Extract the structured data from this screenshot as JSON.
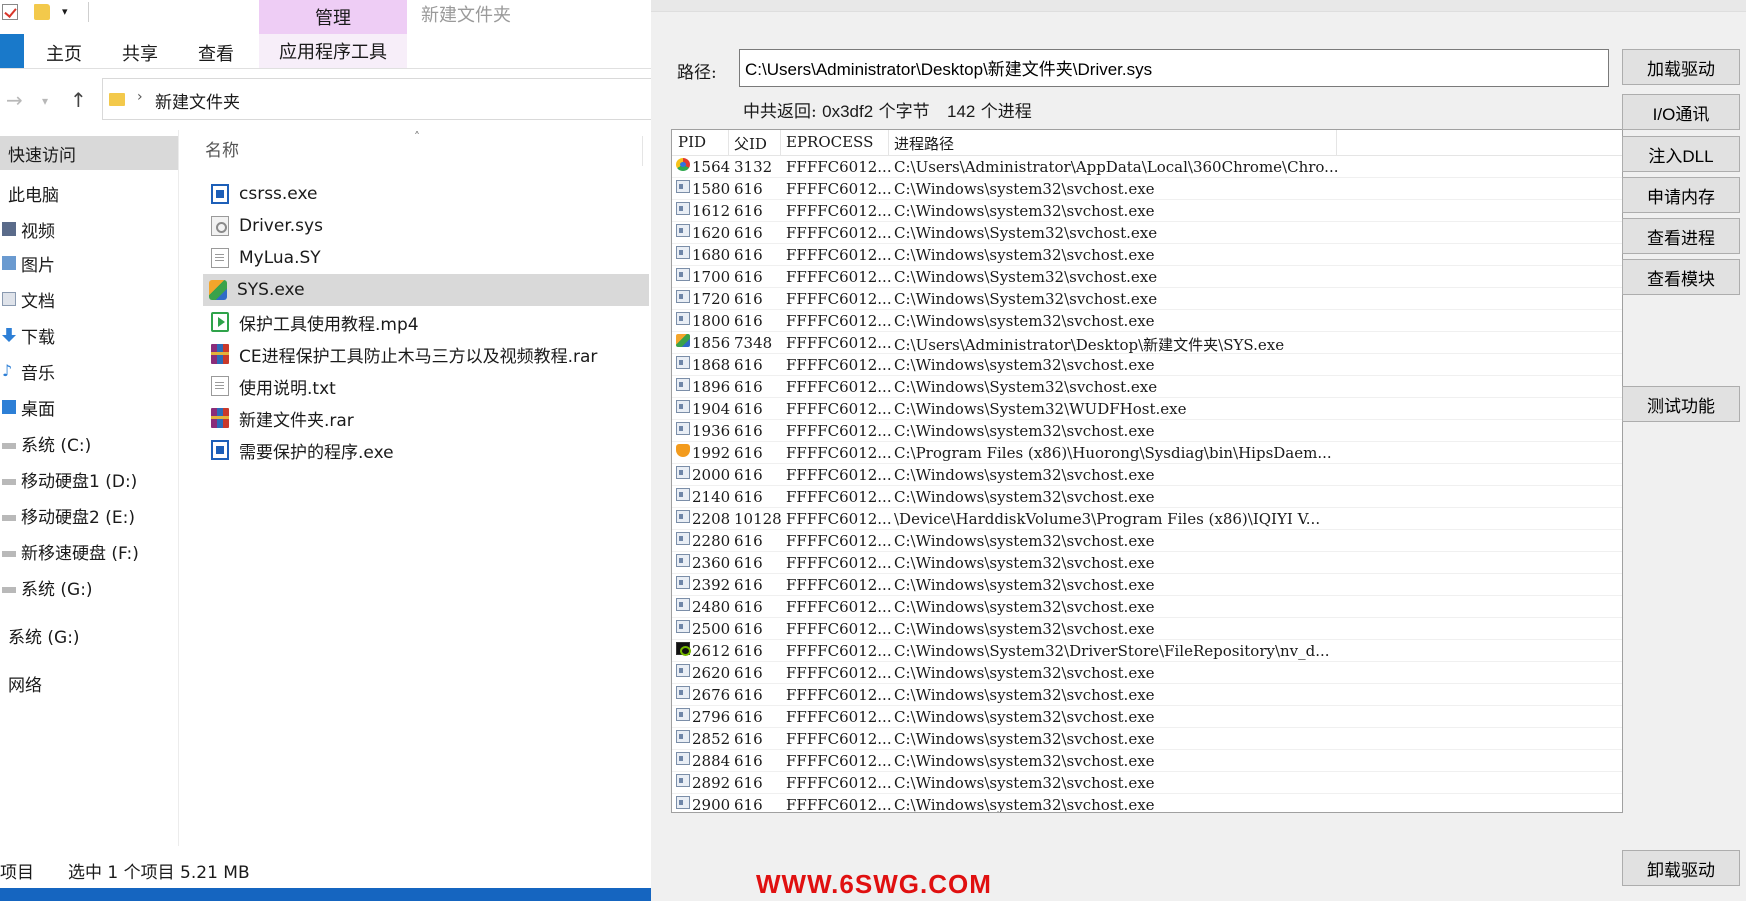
{
  "explorer": {
    "ribbon": {
      "manage_tab": "管理",
      "window_title": "新建文件夹",
      "tabs": [
        "主页",
        "共享",
        "查看"
      ],
      "app_tools_tab": "应用程序工具"
    },
    "address": {
      "current_folder": "新建文件夹"
    },
    "nav": [
      {
        "label": "快速访问",
        "icon": "star-icon"
      },
      {
        "label": "此电脑",
        "icon": "computer-icon"
      },
      {
        "label": "视频",
        "icon": "video-folder-icon"
      },
      {
        "label": "图片",
        "icon": "pictures-folder-icon"
      },
      {
        "label": "文档",
        "icon": "documents-folder-icon"
      },
      {
        "label": "下载",
        "icon": "download-folder-icon"
      },
      {
        "label": "音乐",
        "icon": "music-folder-icon"
      },
      {
        "label": "桌面",
        "icon": "desktop-folder-icon"
      },
      {
        "label": "系统 (C:)",
        "icon": "drive-icon"
      },
      {
        "label": "移动硬盘1 (D:)",
        "icon": "drive-icon"
      },
      {
        "label": "移动硬盘2 (E:)",
        "icon": "drive-icon"
      },
      {
        "label": "新移速硬盘 (F:)",
        "icon": "drive-icon"
      },
      {
        "label": "系统 (G:)",
        "icon": "drive-icon"
      },
      {
        "label": "系统 (G:)",
        "icon": "drive-icon"
      },
      {
        "label": "网络",
        "icon": "network-icon"
      }
    ],
    "column_name": "名称",
    "files": [
      {
        "name": "csrss.exe",
        "type": "exe"
      },
      {
        "name": "Driver.sys",
        "type": "sys"
      },
      {
        "name": "MyLua.SY",
        "type": "doc"
      },
      {
        "name": "SYS.exe",
        "type": "app",
        "selected": true
      },
      {
        "name": "保护工具使用教程.mp4",
        "type": "mp4"
      },
      {
        "name": "CE进程保护工具防止木马三方以及视频教程.rar",
        "type": "rar"
      },
      {
        "name": "使用说明.txt",
        "type": "doc"
      },
      {
        "name": "新建文件夹.rar",
        "type": "rar"
      },
      {
        "name": "需要保护的程序.exe",
        "type": "exe"
      }
    ],
    "status": {
      "items": "项目",
      "selection": "选中 1 个项目  5.21 MB"
    }
  },
  "tool": {
    "path_label": "路径:",
    "path_value": "C:\\Users\\Administrator\\Desktop\\新建文件夹\\Driver.sys",
    "summary": {
      "prefix": "中共返回:",
      "bytes_value": "0x3df2",
      "bytes_unit": "个字节",
      "proc_count": "142",
      "proc_unit": "个进程"
    },
    "columns": [
      "PID",
      "父ID",
      "EPROCESS",
      "进程路径"
    ],
    "processes": [
      {
        "pid": "1564",
        "ppid": "3132",
        "eprocess": "FFFFC6012...",
        "path": "C:\\Users\\Administrator\\AppData\\Local\\360Chrome\\Chro...",
        "icon": "chrome"
      },
      {
        "pid": "1580",
        "ppid": "616",
        "eprocess": "FFFFC6012...",
        "path": "C:\\Windows\\system32\\svchost.exe",
        "icon": "win"
      },
      {
        "pid": "1612",
        "ppid": "616",
        "eprocess": "FFFFC6012...",
        "path": "C:\\Windows\\system32\\svchost.exe",
        "icon": "win"
      },
      {
        "pid": "1620",
        "ppid": "616",
        "eprocess": "FFFFC6012...",
        "path": "C:\\Windows\\System32\\svchost.exe",
        "icon": "win"
      },
      {
        "pid": "1680",
        "ppid": "616",
        "eprocess": "FFFFC6012...",
        "path": "C:\\Windows\\system32\\svchost.exe",
        "icon": "win"
      },
      {
        "pid": "1700",
        "ppid": "616",
        "eprocess": "FFFFC6012...",
        "path": "C:\\Windows\\System32\\svchost.exe",
        "icon": "win"
      },
      {
        "pid": "1720",
        "ppid": "616",
        "eprocess": "FFFFC6012...",
        "path": "C:\\Windows\\System32\\svchost.exe",
        "icon": "win"
      },
      {
        "pid": "1800",
        "ppid": "616",
        "eprocess": "FFFFC6012...",
        "path": "C:\\Windows\\system32\\svchost.exe",
        "icon": "win"
      },
      {
        "pid": "1856",
        "ppid": "7348",
        "eprocess": "FFFFC6012...",
        "path": "C:\\Users\\Administrator\\Desktop\\新建文件夹\\SYS.exe",
        "icon": "sysapp"
      },
      {
        "pid": "1868",
        "ppid": "616",
        "eprocess": "FFFFC6012...",
        "path": "C:\\Windows\\system32\\svchost.exe",
        "icon": "win"
      },
      {
        "pid": "1896",
        "ppid": "616",
        "eprocess": "FFFFC6012...",
        "path": "C:\\Windows\\System32\\svchost.exe",
        "icon": "win"
      },
      {
        "pid": "1904",
        "ppid": "616",
        "eprocess": "FFFFC6012...",
        "path": "C:\\Windows\\System32\\WUDFHost.exe",
        "icon": "win"
      },
      {
        "pid": "1936",
        "ppid": "616",
        "eprocess": "FFFFC6012...",
        "path": "C:\\Windows\\system32\\svchost.exe",
        "icon": "win"
      },
      {
        "pid": "1992",
        "ppid": "616",
        "eprocess": "FFFFC6012...",
        "path": "C:\\Program Files (x86)\\Huorong\\Sysdiag\\bin\\HipsDaem...",
        "icon": "huorong"
      },
      {
        "pid": "2000",
        "ppid": "616",
        "eprocess": "FFFFC6012...",
        "path": "C:\\Windows\\system32\\svchost.exe",
        "icon": "win"
      },
      {
        "pid": "2140",
        "ppid": "616",
        "eprocess": "FFFFC6012...",
        "path": "C:\\Windows\\system32\\svchost.exe",
        "icon": "win"
      },
      {
        "pid": "2208",
        "ppid": "10128",
        "eprocess": "FFFFC6012...",
        "path": "\\Device\\HarddiskVolume3\\Program Files (x86)\\IQIYI V...",
        "icon": "win"
      },
      {
        "pid": "2280",
        "ppid": "616",
        "eprocess": "FFFFC6012...",
        "path": "C:\\Windows\\system32\\svchost.exe",
        "icon": "win"
      },
      {
        "pid": "2360",
        "ppid": "616",
        "eprocess": "FFFFC6012...",
        "path": "C:\\Windows\\system32\\svchost.exe",
        "icon": "win"
      },
      {
        "pid": "2392",
        "ppid": "616",
        "eprocess": "FFFFC6012...",
        "path": "C:\\Windows\\system32\\svchost.exe",
        "icon": "win"
      },
      {
        "pid": "2480",
        "ppid": "616",
        "eprocess": "FFFFC6012...",
        "path": "C:\\Windows\\system32\\svchost.exe",
        "icon": "win"
      },
      {
        "pid": "2500",
        "ppid": "616",
        "eprocess": "FFFFC6012...",
        "path": "C:\\Windows\\system32\\svchost.exe",
        "icon": "win"
      },
      {
        "pid": "2612",
        "ppid": "616",
        "eprocess": "FFFFC6012...",
        "path": "C:\\Windows\\System32\\DriverStore\\FileRepository\\nv_d...",
        "icon": "nvidia"
      },
      {
        "pid": "2620",
        "ppid": "616",
        "eprocess": "FFFFC6012...",
        "path": "C:\\Windows\\system32\\svchost.exe",
        "icon": "win"
      },
      {
        "pid": "2676",
        "ppid": "616",
        "eprocess": "FFFFC6012...",
        "path": "C:\\Windows\\system32\\svchost.exe",
        "icon": "win"
      },
      {
        "pid": "2796",
        "ppid": "616",
        "eprocess": "FFFFC6012...",
        "path": "C:\\Windows\\system32\\svchost.exe",
        "icon": "win"
      },
      {
        "pid": "2852",
        "ppid": "616",
        "eprocess": "FFFFC6012...",
        "path": "C:\\Windows\\system32\\svchost.exe",
        "icon": "win"
      },
      {
        "pid": "2884",
        "ppid": "616",
        "eprocess": "FFFFC6012...",
        "path": "C:\\Windows\\system32\\svchost.exe",
        "icon": "win"
      },
      {
        "pid": "2892",
        "ppid": "616",
        "eprocess": "FFFFC6012...",
        "path": "C:\\Windows\\system32\\svchost.exe",
        "icon": "win"
      },
      {
        "pid": "2900",
        "ppid": "616",
        "eprocess": "FFFFC6012...",
        "path": "C:\\Windows\\system32\\svchost.exe",
        "icon": "win"
      }
    ],
    "buttons": {
      "load_driver": "加载驱动",
      "io_comm": "I/O通讯",
      "inject_dll": "注入DLL",
      "alloc_memory": "申请内存",
      "view_process": "查看进程",
      "view_module": "查看模块",
      "test_function": "测试功能",
      "unload_driver": "卸载驱动"
    },
    "watermark": "WWW.6SWG.COM",
    "watermark_color": "#e01010"
  }
}
